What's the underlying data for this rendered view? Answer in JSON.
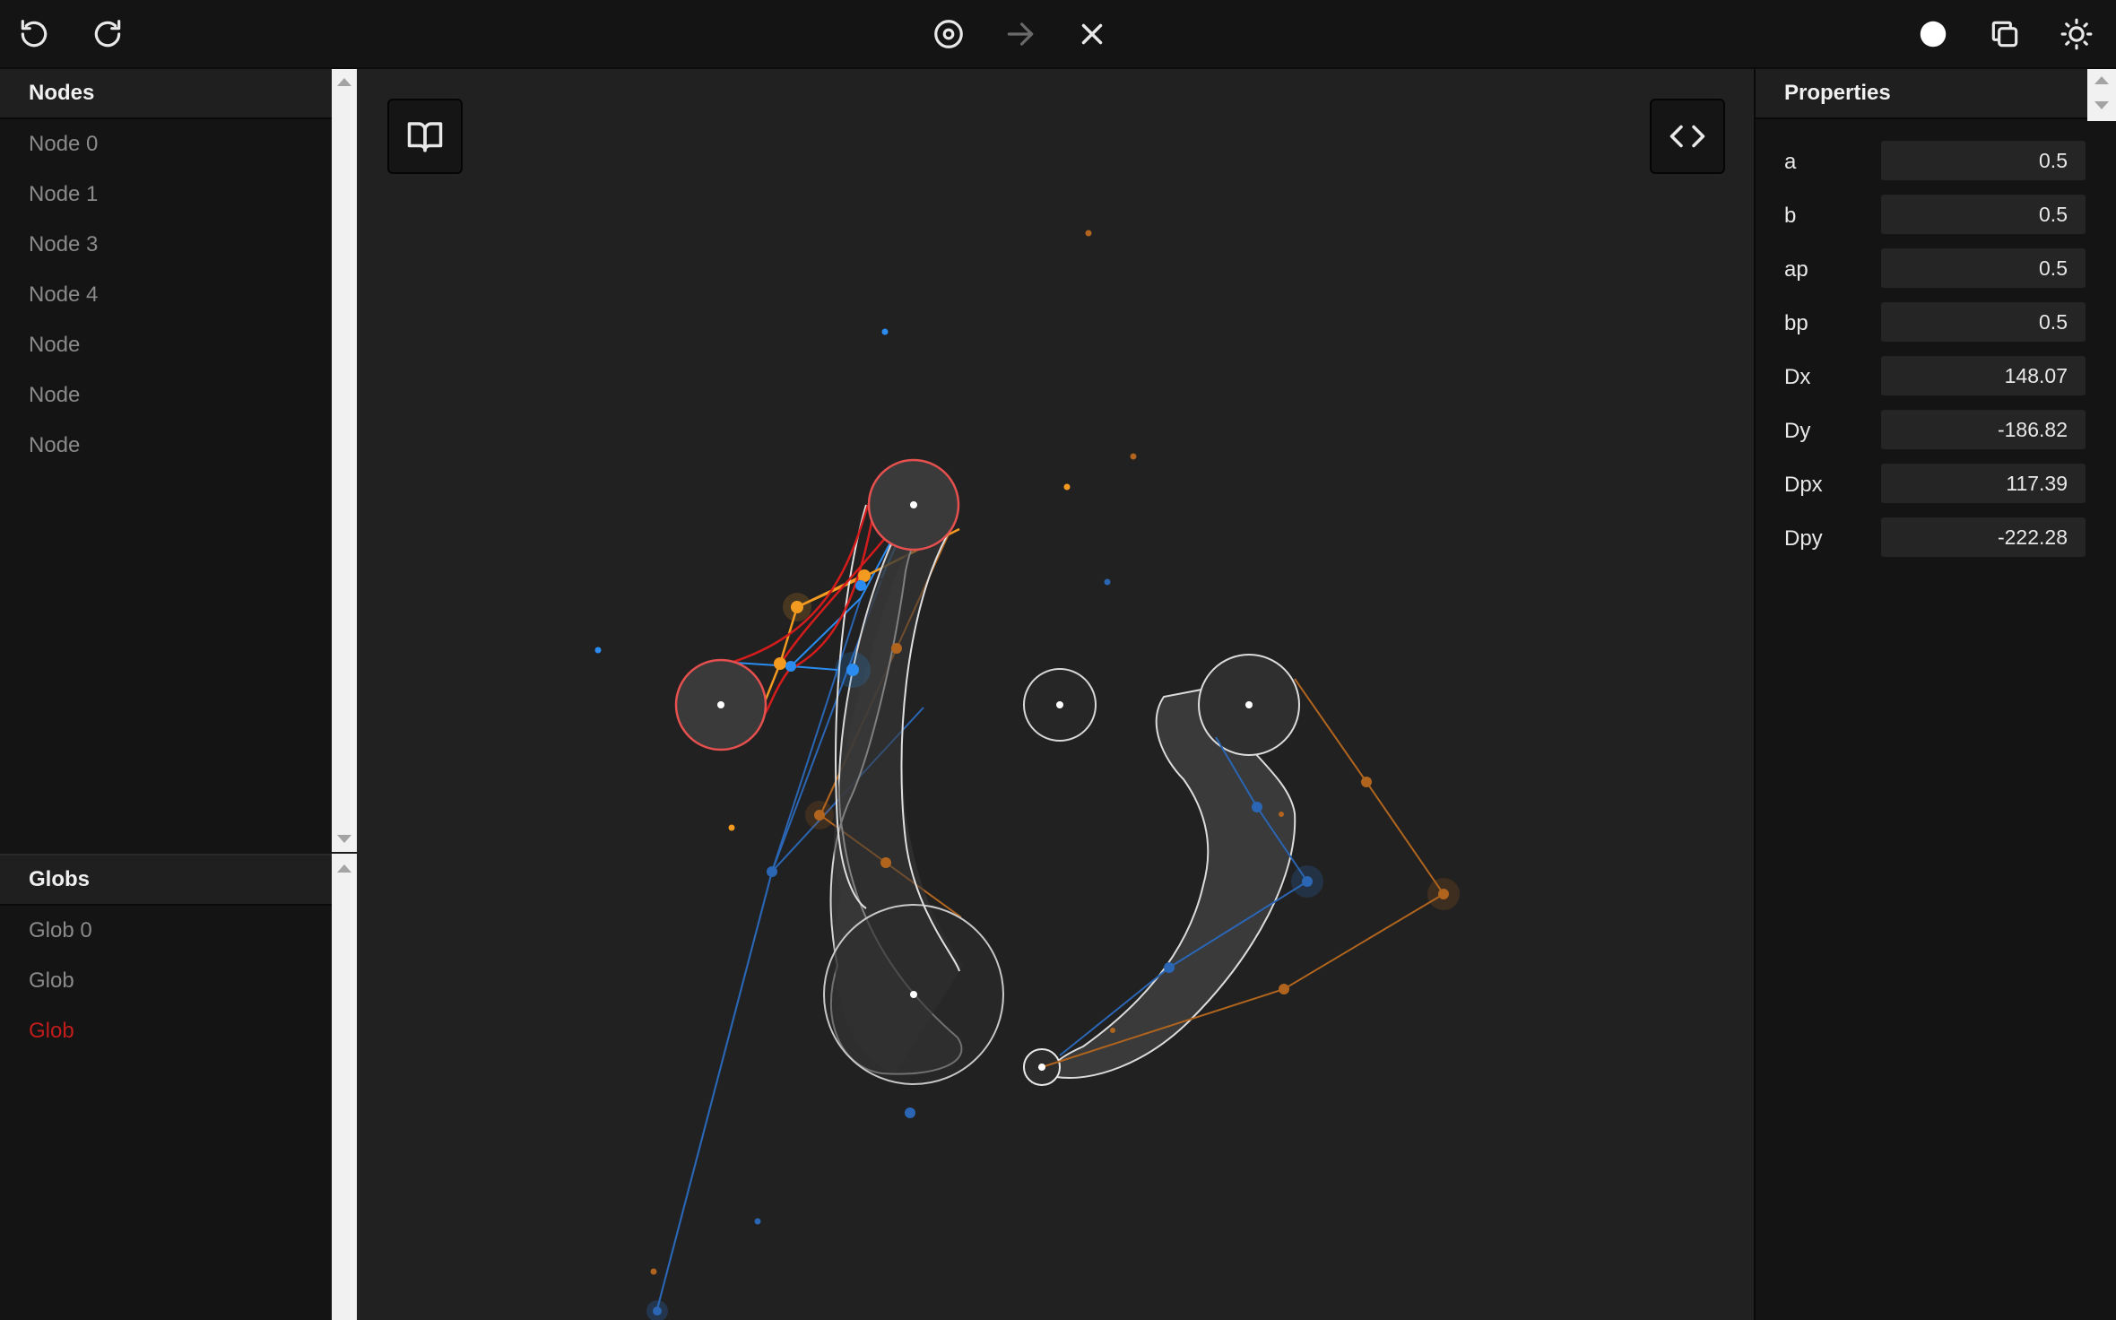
{
  "toolbar": {
    "undo_icon": "undo-icon",
    "redo_icon": "redo-icon",
    "target_icon": "target-icon",
    "arrow_icon": "arrow-right-icon",
    "close_icon": "close-icon",
    "circle_icon": "filled-circle-icon",
    "copy_icon": "copy-icon",
    "theme_icon": "sun-icon"
  },
  "nodes_panel": {
    "title": "Nodes",
    "items": [
      "Node 0",
      "Node 1",
      "Node 3",
      "Node 4",
      "Node",
      "Node",
      "Node"
    ]
  },
  "globs_panel": {
    "title": "Globs",
    "items": [
      "Glob 0",
      "Glob",
      "Glob"
    ]
  },
  "properties_panel": {
    "title": "Properties",
    "rows": [
      {
        "label": "a",
        "value": "0.5"
      },
      {
        "label": "b",
        "value": "0.5"
      },
      {
        "label": "ap",
        "value": "0.5"
      },
      {
        "label": "bp",
        "value": "0.5"
      },
      {
        "label": "Dx",
        "value": "148.07"
      },
      {
        "label": "Dy",
        "value": "-186.82"
      },
      {
        "label": "Dpx",
        "value": "117.39"
      },
      {
        "label": "Dpy",
        "value": "-222.28"
      }
    ]
  },
  "canvas": {
    "docs_icon": "book-icon",
    "code_icon": "code-icon"
  },
  "colors": {
    "background": "#212121",
    "panel": "#141414",
    "accent_blue": "#2b8bf0",
    "accent_orange": "#f39a20",
    "selected_red": "#e6504f",
    "danger_text": "#c01c1c"
  }
}
